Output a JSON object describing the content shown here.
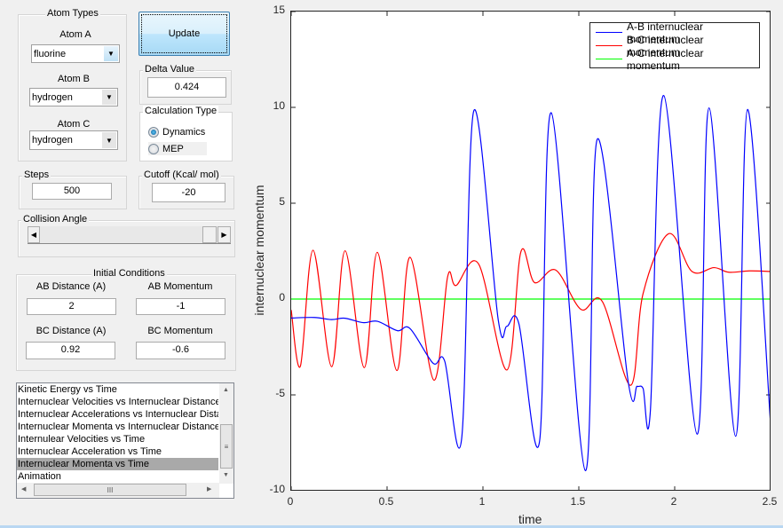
{
  "atom_types": {
    "title": "Atom Types",
    "atom_a_label": "Atom A",
    "atom_a_value": "fluorine",
    "atom_b_label": "Atom B",
    "atom_b_value": "hydrogen",
    "atom_c_label": "Atom C",
    "atom_c_value": "hydrogen"
  },
  "update_label": "Update",
  "delta": {
    "title": "Delta Value",
    "value": "0.424"
  },
  "calc_type": {
    "title": "Calculation Type",
    "options": [
      "Dynamics",
      "MEP"
    ],
    "selected": "Dynamics"
  },
  "steps": {
    "title": "Steps",
    "value": "500"
  },
  "cutoff": {
    "title": "Cutoff (Kcal/ mol)",
    "value": "-20"
  },
  "collision": {
    "title": "Collision Angle",
    "slider_value": 0.95
  },
  "initial": {
    "title": "Initial Conditions",
    "ab_dist_label": "AB Distance (A)",
    "ab_dist": "2",
    "ab_mom_label": "AB Momentum",
    "ab_mom": "-1",
    "bc_dist_label": "BC Distance (A)",
    "bc_dist": "0.92",
    "bc_mom_label": "BC Momentum",
    "bc_mom": "-0.6"
  },
  "plot_list": {
    "items": [
      "Kinetic Energy vs Time",
      "Internuclear Velocities vs Internuclear Distance",
      "Internuclear Accelerations vs Internuclear Distance",
      "Internuclear Momenta vs Internuclear Distance",
      "Internulear Velocities vs Time",
      "Internuclear Acceleration vs Time",
      "Internuclear Momenta vs Time",
      "Animation"
    ],
    "selected_index": 6
  },
  "chart_data": {
    "type": "line",
    "xlabel": "time",
    "ylabel": "internuclear momentum",
    "xlim": [
      0,
      2.5
    ],
    "ylim": [
      -10,
      15
    ],
    "xticks": [
      "0",
      "0.5",
      "1",
      "1.5",
      "2",
      "2.5"
    ],
    "yticks": [
      "-10",
      "-5",
      "0",
      "5",
      "10",
      "15"
    ],
    "legend_position": "top-right",
    "series": [
      {
        "name": "A-B internuclear momentum",
        "color": "#0000ff",
        "points": [
          [
            0,
            -0.99
          ],
          [
            0.12,
            -0.96
          ],
          [
            0.21,
            -1.07
          ],
          [
            0.28,
            -1.0
          ],
          [
            0.375,
            -1.23
          ],
          [
            0.45,
            -1.16
          ],
          [
            0.554,
            -1.65
          ],
          [
            0.62,
            -1.54
          ],
          [
            0.74,
            -3.35
          ],
          [
            0.8,
            -3.22
          ],
          [
            0.889,
            -7.28
          ],
          [
            0.952,
            9.81
          ],
          [
            1.08,
            -1.1
          ],
          [
            1.125,
            -1.42
          ],
          [
            1.187,
            -1.27
          ],
          [
            1.295,
            -7.44
          ],
          [
            1.356,
            9.72
          ],
          [
            1.534,
            -8.95
          ],
          [
            1.596,
            8.33
          ],
          [
            1.758,
            -4.35
          ],
          [
            1.804,
            -4.55
          ],
          [
            1.835,
            -4.66
          ],
          [
            1.873,
            -5.86
          ],
          [
            1.943,
            10.62
          ],
          [
            2.117,
            -7.05
          ],
          [
            2.179,
            9.97
          ],
          [
            2.318,
            -7.16
          ],
          [
            2.38,
            9.89
          ],
          [
            2.5,
            -6.51
          ]
        ]
      },
      {
        "name": "B-C internuclear momentum",
        "color": "#ff0000",
        "points": [
          [
            0,
            -0.57
          ],
          [
            0.048,
            -3.5
          ],
          [
            0.114,
            2.55
          ],
          [
            0.211,
            -3.53
          ],
          [
            0.281,
            2.52
          ],
          [
            0.381,
            -3.58
          ],
          [
            0.449,
            2.44
          ],
          [
            0.551,
            -3.73
          ],
          [
            0.62,
            2.18
          ],
          [
            0.744,
            -4.23
          ],
          [
            0.816,
            1.17
          ],
          [
            0.86,
            0.71
          ],
          [
            0.978,
            1.82
          ],
          [
            1.125,
            -3.7
          ],
          [
            1.198,
            2.47
          ],
          [
            1.269,
            0.86
          ],
          [
            1.38,
            1.51
          ],
          [
            1.511,
            -0.54
          ],
          [
            1.622,
            -0.12
          ],
          [
            1.77,
            -4.5
          ],
          [
            1.835,
            0.28
          ],
          [
            1.969,
            3.41
          ],
          [
            2.09,
            1.44
          ],
          [
            2.205,
            1.64
          ],
          [
            2.282,
            1.4
          ],
          [
            2.39,
            1.47
          ],
          [
            2.5,
            1.44
          ]
        ]
      },
      {
        "name": "A-C internuclear momentum",
        "color": "#00ff00",
        "points": [
          [
            0,
            0
          ],
          [
            2.5,
            0
          ]
        ]
      }
    ]
  }
}
